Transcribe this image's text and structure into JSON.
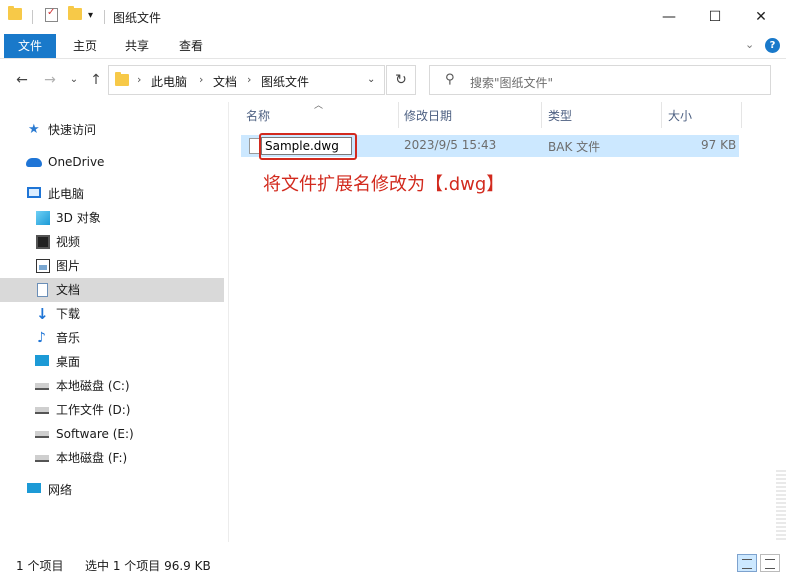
{
  "window": {
    "title": "图纸文件",
    "minimize": "—",
    "maximize": "☐",
    "close": "✕"
  },
  "ribbon": {
    "tabs": [
      "文件",
      "主页",
      "共享",
      "查看"
    ],
    "expand": "⌄",
    "help": "?"
  },
  "nav": {
    "back": "←",
    "forward": "→",
    "recent": "⌄",
    "up": "↑",
    "breadcrumb": [
      "此电脑",
      "文档",
      "图纸文件"
    ],
    "crumb_sep": "›",
    "dropdown": "⌄",
    "refresh": "↻"
  },
  "search": {
    "placeholder": "搜索\"图纸文件\"",
    "icon": "search-icon"
  },
  "sidebar": {
    "items": [
      {
        "label": "快速访问",
        "icon": "star-icon"
      },
      {
        "label": "OneDrive",
        "icon": "cloud-icon"
      },
      {
        "label": "此电脑",
        "icon": "computer-icon"
      },
      {
        "label": "3D 对象",
        "icon": "3d-objects-icon"
      },
      {
        "label": "视频",
        "icon": "video-icon"
      },
      {
        "label": "图片",
        "icon": "pictures-icon"
      },
      {
        "label": "文档",
        "icon": "documents-icon",
        "selected": true
      },
      {
        "label": "下载",
        "icon": "download-icon"
      },
      {
        "label": "音乐",
        "icon": "music-icon"
      },
      {
        "label": "桌面",
        "icon": "desktop-icon"
      },
      {
        "label": "本地磁盘 (C:)",
        "icon": "drive-icon"
      },
      {
        "label": "工作文件 (D:)",
        "icon": "drive-icon"
      },
      {
        "label": "Software (E:)",
        "icon": "drive-icon"
      },
      {
        "label": "本地磁盘 (F:)",
        "icon": "drive-icon"
      },
      {
        "label": "网络",
        "icon": "network-icon"
      }
    ]
  },
  "columns": [
    "名称",
    "修改日期",
    "类型",
    "大小"
  ],
  "files": [
    {
      "name": "Sample.dwg",
      "modified": "2023/9/5 15:43",
      "type": "BAK 文件",
      "size": "97 KB",
      "selected": true,
      "renaming": true
    }
  ],
  "annotation": "将文件扩展名修改为【.dwg】",
  "status": {
    "count": "1 个项目",
    "selected": "选中 1 个项目  96.9 KB"
  }
}
